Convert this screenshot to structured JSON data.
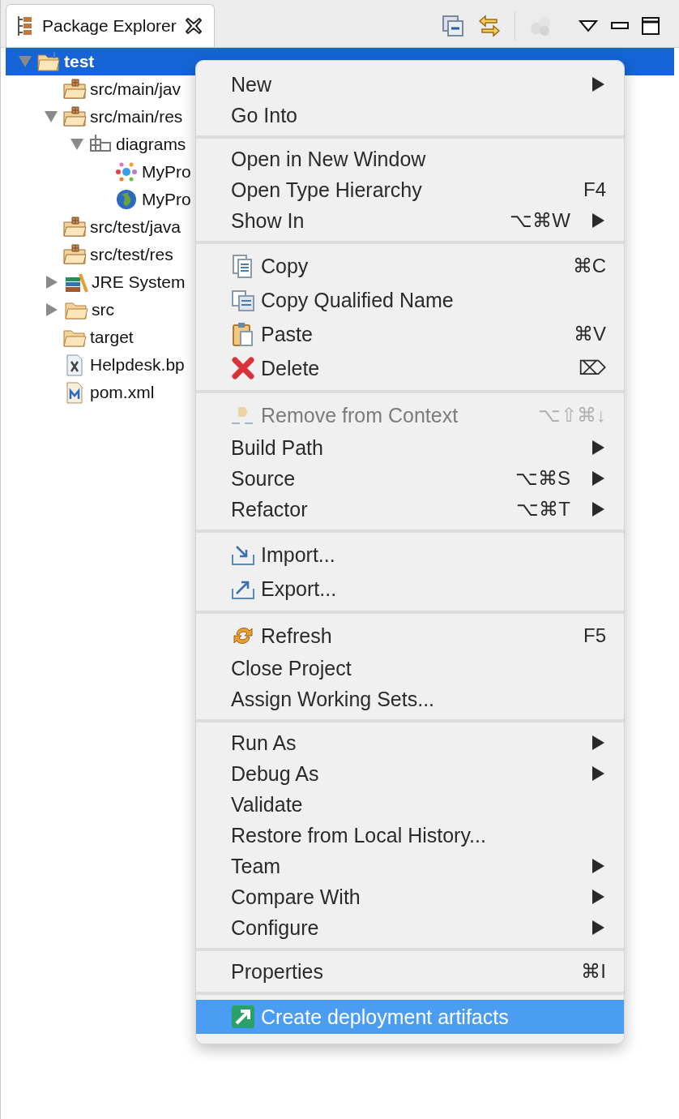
{
  "view": {
    "tab": {
      "title": "Package Explorer"
    }
  },
  "tree": [
    {
      "label": "test",
      "kind": "project",
      "selected": true,
      "expanded": true,
      "children": [
        {
          "label": "src/main/jav",
          "kind": "package-folder",
          "selected": false
        },
        {
          "label": "src/main/res",
          "kind": "package-folder",
          "selected": false,
          "expanded": true,
          "children": [
            {
              "label": "diagrams",
              "kind": "package",
              "selected": false,
              "expanded": true,
              "children": [
                {
                  "label": "MyPro",
                  "kind": "process",
                  "selected": false
                },
                {
                  "label": "MyPro",
                  "kind": "globe",
                  "selected": false
                }
              ]
            }
          ]
        },
        {
          "label": "src/test/java",
          "kind": "package-folder",
          "selected": false
        },
        {
          "label": "src/test/res",
          "kind": "package-folder",
          "selected": false
        },
        {
          "label": "JRE System",
          "kind": "library",
          "selected": false,
          "expanded": false
        },
        {
          "label": "src",
          "kind": "folder",
          "selected": false,
          "expanded": false
        },
        {
          "label": "target",
          "kind": "folder",
          "selected": false
        },
        {
          "label": "Helpdesk.bp",
          "kind": "xfile",
          "selected": false
        },
        {
          "label": "pom.xml",
          "kind": "mfile",
          "selected": false
        }
      ]
    }
  ],
  "menu": [
    [
      {
        "label": "New",
        "kind": "plain",
        "submenu": true,
        "disabled": false,
        "selected": false
      },
      {
        "label": "Go Into",
        "kind": "plain",
        "submenu": false,
        "disabled": false,
        "selected": false
      }
    ],
    [
      {
        "label": "Open in New Window",
        "kind": "plain",
        "submenu": false,
        "disabled": false,
        "selected": false
      },
      {
        "label": "Open Type Hierarchy",
        "kind": "plain",
        "shortcut": "F4",
        "submenu": false,
        "disabled": false,
        "selected": false
      },
      {
        "label": "Show In",
        "kind": "plain",
        "shortcut": "⌥⌘W",
        "submenu": true,
        "disabled": false,
        "selected": false
      }
    ],
    [
      {
        "label": "Copy",
        "kind": "copy",
        "shortcut": "⌘C",
        "submenu": false,
        "disabled": false,
        "selected": false
      },
      {
        "label": "Copy Qualified Name",
        "kind": "copy-name",
        "submenu": false,
        "disabled": false,
        "selected": false
      },
      {
        "label": "Paste",
        "kind": "paste",
        "shortcut": "⌘V",
        "submenu": false,
        "disabled": false,
        "selected": false
      },
      {
        "label": "Delete",
        "kind": "delete",
        "shortcut": "⌦",
        "submenu": false,
        "disabled": false,
        "selected": false
      }
    ],
    [
      {
        "label": "Remove from Context",
        "kind": "remove",
        "shortcut": "⌥⇧⌘↓",
        "submenu": false,
        "disabled": true,
        "selected": false
      },
      {
        "label": "Build Path",
        "kind": "plain",
        "submenu": true,
        "disabled": false,
        "selected": false
      },
      {
        "label": "Source",
        "kind": "plain",
        "shortcut": "⌥⌘S",
        "submenu": true,
        "disabled": false,
        "selected": false
      },
      {
        "label": "Refactor",
        "kind": "plain",
        "shortcut": "⌥⌘T",
        "submenu": true,
        "disabled": false,
        "selected": false
      }
    ],
    [
      {
        "label": "Import...",
        "kind": "import",
        "submenu": false,
        "disabled": false,
        "selected": false
      },
      {
        "label": "Export...",
        "kind": "export",
        "submenu": false,
        "disabled": false,
        "selected": false
      }
    ],
    [
      {
        "label": "Refresh",
        "kind": "refresh",
        "shortcut": "F5",
        "submenu": false,
        "disabled": false,
        "selected": false
      },
      {
        "label": "Close Project",
        "kind": "plain",
        "submenu": false,
        "disabled": false,
        "selected": false
      },
      {
        "label": "Assign Working Sets...",
        "kind": "plain",
        "submenu": false,
        "disabled": false,
        "selected": false
      }
    ],
    [
      {
        "label": "Run As",
        "kind": "plain",
        "submenu": true,
        "disabled": false,
        "selected": false
      },
      {
        "label": "Debug As",
        "kind": "plain",
        "submenu": true,
        "disabled": false,
        "selected": false
      },
      {
        "label": "Validate",
        "kind": "plain",
        "submenu": false,
        "disabled": false,
        "selected": false
      },
      {
        "label": "Restore from Local History...",
        "kind": "plain",
        "submenu": false,
        "disabled": false,
        "selected": false
      },
      {
        "label": "Team",
        "kind": "plain",
        "submenu": true,
        "disabled": false,
        "selected": false
      },
      {
        "label": "Compare With",
        "kind": "plain",
        "submenu": true,
        "disabled": false,
        "selected": false
      },
      {
        "label": "Configure",
        "kind": "plain",
        "submenu": true,
        "disabled": false,
        "selected": false
      }
    ],
    [
      {
        "label": "Properties",
        "kind": "plain",
        "shortcut": "⌘I",
        "submenu": false,
        "disabled": false,
        "selected": false
      }
    ],
    [
      {
        "label": "Create deployment artifacts",
        "kind": "deploy",
        "submenu": false,
        "disabled": false,
        "selected": true
      }
    ]
  ]
}
